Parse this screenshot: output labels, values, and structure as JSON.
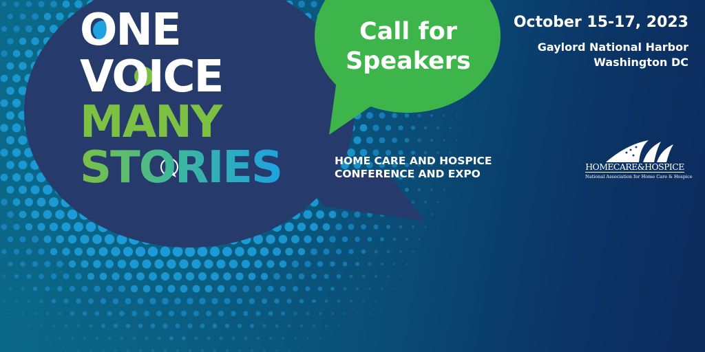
{
  "headline": {
    "line1": "ONE",
    "line2": "VOICE",
    "line3": "MANY",
    "line4": "STORIES"
  },
  "callout": {
    "line1": "Call for",
    "line2": "Speakers"
  },
  "event": {
    "date": "October 15-17, 2023",
    "venue": "Gaylord National Harbor",
    "city": "Washington DC"
  },
  "conference": {
    "line1": "HOME CARE AND HOSPICE",
    "line2": "CONFERENCE AND EXPO"
  },
  "logo": {
    "wordmark": "HOMECARE&HOSPICE",
    "tagline": "National Association for Home Care & Hospice"
  },
  "colors": {
    "navy_bubble": "#263a6b",
    "green_bubble": "#3db54a",
    "accent_green": "#7cc143",
    "accent_blue": "#1fa2e0",
    "white": "#ffffff"
  }
}
